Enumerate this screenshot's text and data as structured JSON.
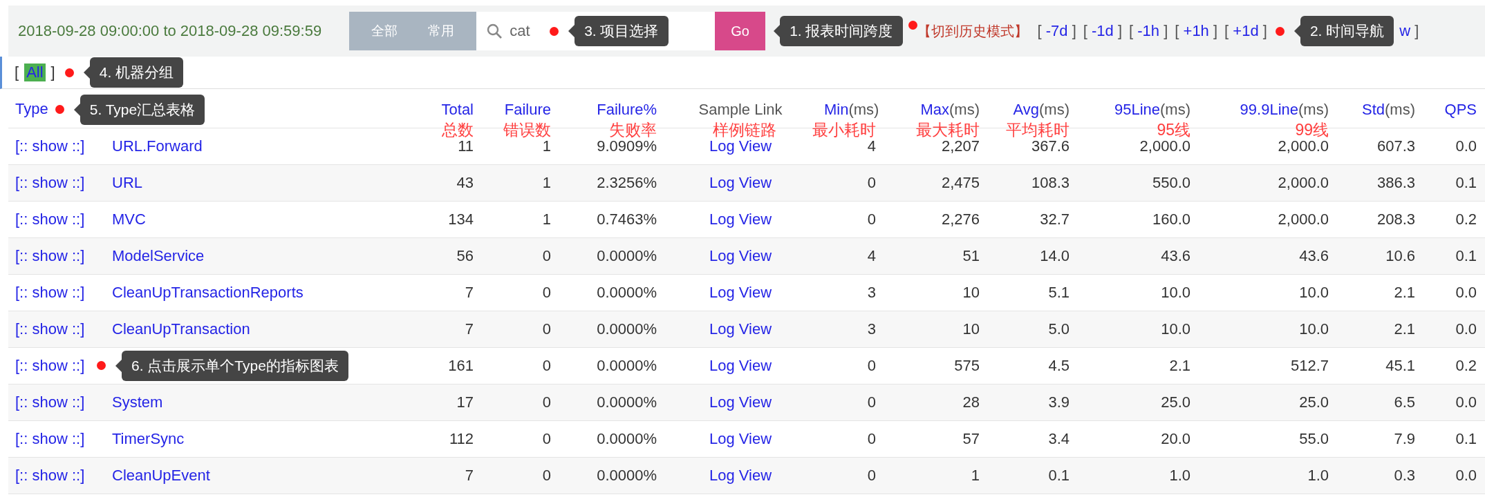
{
  "header": {
    "time_range": "2018-09-28 09:00:00 to 2018-09-28 09:59:59",
    "domain_tabs": [
      {
        "label": "全部"
      },
      {
        "label": "常用"
      }
    ],
    "search": {
      "value": "cat",
      "tooltip": "3. 项目选择"
    },
    "go_button": "Go",
    "go_tooltip": "1. 报表时间跨度",
    "history_link": "【切到历史模式】",
    "time_nav": [
      {
        "left": "[",
        "label": "-7d",
        "right": "]"
      },
      {
        "left": "[",
        "label": "-1d",
        "right": "]"
      },
      {
        "left": "[",
        "label": "-1h",
        "right": "]"
      },
      {
        "left": "[",
        "label": "+1h",
        "right": "]"
      },
      {
        "left": "[",
        "label": "+1d",
        "right": "]"
      }
    ],
    "nav_tooltip": "2. 时间导航",
    "nav_tail": {
      "label": "w",
      "right": "]"
    }
  },
  "machine_group": {
    "left": "[",
    "items": [
      {
        "label": "All",
        "selected": true
      }
    ],
    "right": "]",
    "tooltip": "4. 机器分组"
  },
  "table": {
    "type_tooltip": "5. Type汇总表格",
    "columns": [
      {
        "kind": "link",
        "label": "Type"
      },
      {
        "kind": "link",
        "label": "Total",
        "note": "总数"
      },
      {
        "kind": "link",
        "label": "Failure",
        "note": "错误数"
      },
      {
        "kind": "link",
        "label": "Failure%",
        "note": "失败率"
      },
      {
        "kind": "plain",
        "label": "Sample Link",
        "note": "样例链路"
      },
      {
        "kind": "link",
        "label": "Min",
        "unit": "(ms)",
        "note": "最小耗时"
      },
      {
        "kind": "link",
        "label": "Max",
        "unit": "(ms)",
        "note": "最大耗时"
      },
      {
        "kind": "link",
        "label": "Avg",
        "unit": "(ms)",
        "note": "平均耗时"
      },
      {
        "kind": "link",
        "label": "95Line",
        "unit": "(ms)",
        "note": "95线"
      },
      {
        "kind": "link",
        "label": "99.9Line",
        "unit": "(ms)",
        "note": "99线"
      },
      {
        "kind": "link",
        "label": "Std",
        "unit": "(ms)"
      },
      {
        "kind": "link",
        "label": "QPS"
      }
    ],
    "rows": [
      {
        "show": "[:: show ::]",
        "type": "URL.Forward",
        "total": "11",
        "failure": "1",
        "failure_pct": "9.0909%",
        "sample": "Log View",
        "min": "4",
        "max": "2,207",
        "avg": "367.6",
        "p95": "2,000.0",
        "p999": "2,000.0",
        "std": "607.3",
        "qps": "0.0"
      },
      {
        "show": "[:: show ::]",
        "type": "URL",
        "total": "43",
        "failure": "1",
        "failure_pct": "2.3256%",
        "sample": "Log View",
        "min": "0",
        "max": "2,475",
        "avg": "108.3",
        "p95": "550.0",
        "p999": "2,000.0",
        "std": "386.3",
        "qps": "0.1"
      },
      {
        "show": "[:: show ::]",
        "type": "MVC",
        "total": "134",
        "failure": "1",
        "failure_pct": "0.7463%",
        "sample": "Log View",
        "min": "0",
        "max": "2,276",
        "avg": "32.7",
        "p95": "160.0",
        "p999": "2,000.0",
        "std": "208.3",
        "qps": "0.2"
      },
      {
        "show": "[:: show ::]",
        "type": "ModelService",
        "total": "56",
        "failure": "0",
        "failure_pct": "0.0000%",
        "sample": "Log View",
        "min": "4",
        "max": "51",
        "avg": "14.0",
        "p95": "43.6",
        "p999": "43.6",
        "std": "10.6",
        "qps": "0.1"
      },
      {
        "show": "[:: show ::]",
        "type": "CleanUpTransactionReports",
        "total": "7",
        "failure": "0",
        "failure_pct": "0.0000%",
        "sample": "Log View",
        "min": "3",
        "max": "10",
        "avg": "5.1",
        "p95": "10.0",
        "p999": "10.0",
        "std": "2.1",
        "qps": "0.0"
      },
      {
        "show": "[:: show ::]",
        "type": "CleanUpTransaction",
        "total": "7",
        "failure": "0",
        "failure_pct": "0.0000%",
        "sample": "Log View",
        "min": "3",
        "max": "10",
        "avg": "5.0",
        "p95": "10.0",
        "p999": "10.0",
        "std": "2.1",
        "qps": "0.0"
      },
      {
        "show": "[:: show ::]",
        "tooltip": "6. 点击展示单个Type的指标图表",
        "total": "161",
        "failure": "0",
        "failure_pct": "0.0000%",
        "sample": "Log View",
        "min": "0",
        "max": "575",
        "avg": "4.5",
        "p95": "2.1",
        "p999": "512.7",
        "std": "45.1",
        "qps": "0.2"
      },
      {
        "show": "[:: show ::]",
        "type": "System",
        "total": "17",
        "failure": "0",
        "failure_pct": "0.0000%",
        "sample": "Log View",
        "min": "0",
        "max": "28",
        "avg": "3.9",
        "p95": "25.0",
        "p999": "25.0",
        "std": "6.5",
        "qps": "0.0"
      },
      {
        "show": "[:: show ::]",
        "type": "TimerSync",
        "total": "112",
        "failure": "0",
        "failure_pct": "0.0000%",
        "sample": "Log View",
        "min": "0",
        "max": "57",
        "avg": "3.4",
        "p95": "20.0",
        "p999": "55.0",
        "std": "7.9",
        "qps": "0.1"
      },
      {
        "show": "[:: show ::]",
        "type": "CleanUpEvent",
        "total": "7",
        "failure": "0",
        "failure_pct": "0.0000%",
        "sample": "Log View",
        "min": "0",
        "max": "1",
        "avg": "0.1",
        "p95": "1.0",
        "p999": "1.0",
        "std": "0.3",
        "qps": "0.0"
      }
    ]
  }
}
